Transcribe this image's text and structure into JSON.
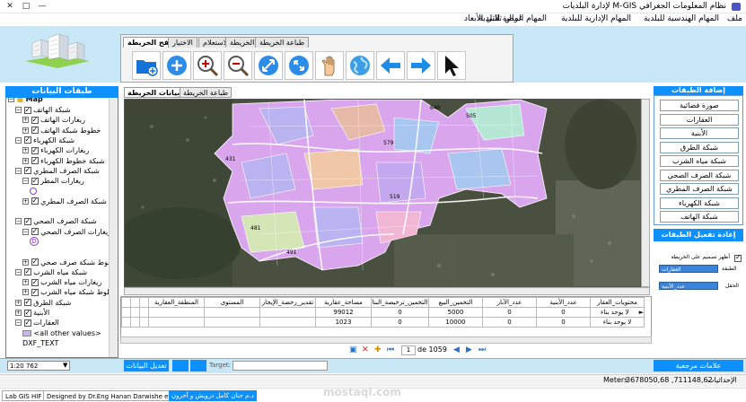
{
  "window": {
    "title": "نظام المعلومات الجغرافي M-GIS لإدارة البلديات",
    "controls": [
      "✕",
      "□",
      "—"
    ]
  },
  "menubar": {
    "items": [
      "ملف",
      "المهام الهندسية للبلدية",
      "المهام الإدارية للبلدية",
      "المهام المالية للبلدية",
      "عرض ثلاثي الأبعاد"
    ]
  },
  "ribbon": {
    "tabs": [
      "تصفح الخريطة",
      "الاختيار",
      "الاستعلام",
      "طباعة الخريطة",
      "طباعة الخريطة"
    ],
    "tools": [
      "add-layer-icon",
      "zoom-in-button-icon",
      "zoom-in-magnifier-icon",
      "zoom-out-magnifier-icon",
      "full-extent-icon",
      "fixed-zoom-icon",
      "pan-hand-icon",
      "globe-icon",
      "previous-extent-icon",
      "next-extent-icon",
      "select-arrow-icon"
    ]
  },
  "layers_panel": {
    "title": "طبقات البيانات",
    "root": "Map",
    "items": [
      {
        "indent": 1,
        "toggle": "−",
        "checked": true,
        "label": "شبكة الهاتف"
      },
      {
        "indent": 2,
        "toggle": "+",
        "checked": true,
        "label": "ريغارات الهاتف"
      },
      {
        "indent": 2,
        "toggle": "+",
        "checked": true,
        "label": "خطوط شبكة الهاتف"
      },
      {
        "indent": 1,
        "toggle": "−",
        "checked": true,
        "label": "شبكة الكهرباء"
      },
      {
        "indent": 2,
        "toggle": "+",
        "checked": true,
        "label": "ريغارات الكهرباء"
      },
      {
        "indent": 2,
        "toggle": "+",
        "checked": true,
        "label": "شبكة خطوط الكهرباء"
      },
      {
        "indent": 1,
        "toggle": "−",
        "checked": true,
        "label": "شبكة الصرف المطري"
      },
      {
        "indent": 2,
        "toggle": "−",
        "checked": true,
        "label": "ريغارات المطر"
      },
      {
        "indent": 3,
        "symbol": "circle",
        "label": ""
      },
      {
        "indent": 2,
        "toggle": "+",
        "checked": true,
        "label": "شبكة الصرف المطري"
      },
      {
        "indent": 1,
        "toggle": "",
        "checked": false,
        "label": ""
      },
      {
        "indent": 1,
        "toggle": "−",
        "checked": true,
        "label": "شبكة الصرف الصحي"
      },
      {
        "indent": 2,
        "toggle": "−",
        "checked": true,
        "label": "ريغارات الصرف الصحي"
      },
      {
        "indent": 3,
        "symbol": "D",
        "label": ""
      },
      {
        "indent": 1,
        "toggle": "",
        "checked": false,
        "label": ""
      },
      {
        "indent": 2,
        "toggle": "+",
        "checked": true,
        "label": "خطوط شبكة صرف صحي"
      },
      {
        "indent": 1,
        "toggle": "−",
        "checked": true,
        "label": "شبكة مياه الشرب"
      },
      {
        "indent": 2,
        "toggle": "+",
        "checked": true,
        "label": "ريغارات مياه الشرب"
      },
      {
        "indent": 2,
        "toggle": "+",
        "checked": true,
        "label": "خطوط شبكة مياه الشرب"
      },
      {
        "indent": 1,
        "toggle": "+",
        "checked": true,
        "label": "شبكة الطرق"
      },
      {
        "indent": 1,
        "toggle": "+",
        "checked": true,
        "label": "الأبنية"
      },
      {
        "indent": 1,
        "toggle": "−",
        "checked": true,
        "label": "العقارات"
      },
      {
        "indent": 2,
        "symbol": "swatch",
        "label": "<all other values>"
      },
      {
        "indent": 2,
        "toggle": "",
        "checked": false,
        "label": "DXF_TEXT"
      }
    ]
  },
  "map_tabs": [
    "عرض بيانات الخريطة",
    "طباعة الخريطة"
  ],
  "map": {
    "parcel_labels": [
      "640",
      "431",
      "481",
      "579",
      "505",
      "519",
      "491"
    ],
    "parcel_fill": "#d9a6ee",
    "parcel_alt": "#b9b4f1",
    "road": "#ffffff",
    "terrain": "#4a5040"
  },
  "attribute_table": {
    "columns": [
      "محتويات_العقار",
      "عدد_الأبنية",
      "عدد_الآبار",
      "التخمين_البيع",
      "التخمين_ترخيصة_البنا",
      "مساحة_عقارية",
      "تقدير_رخصة_الإيجار",
      "المستوى",
      "المنطقة_العقارية"
    ],
    "rows": [
      {
        "marker": "►",
        "cells": [
          "لا يوجد بناء",
          "0",
          "0",
          "5000",
          "0",
          "99012",
          "",
          "",
          ""
        ]
      },
      {
        "marker": "",
        "cells": [
          "لا يوجد بناء",
          "0",
          "0",
          "10000",
          "0",
          "1023",
          "",
          "",
          ""
        ]
      }
    ]
  },
  "navigator": {
    "current": "1",
    "of_label": "de 1059"
  },
  "right_panel": {
    "title": "إضافة الطبقات",
    "layer_buttons": [
      "صورة فضائية",
      "العقارات",
      "الأبنية",
      "شبكة الطرق",
      "شبكة مياه الشرب",
      "شبكة الصرف الصحي",
      "شبكة الصرف المطري",
      "شبكة الكهرباء",
      "شبكة الهاتف"
    ],
    "refresh_button": "إعادة تفعيل الطبقات",
    "overview_label": "أظهر تصميم على الخريطة",
    "layer_label": "الطبقة",
    "layer_value": "العقارات",
    "field_label": "الحقل",
    "field_value": "عدد_الأبنية"
  },
  "bottom_bar": {
    "scale": "1:20 762",
    "edit_button": "تعديل البيانات",
    "target_label": "Target:",
    "marks_button": "علامات مرجعية"
  },
  "status_bar": {
    "coords_label": "الإحداثيات",
    "coords": "3678050,68 ,711148,62",
    "units": "Meters"
  },
  "credits": {
    "lab": "Lab GIS HIF",
    "designer": "Designed by Dr.Eng Hanan Darwishe et al.",
    "arabic": "د.م حنان كامل درويش و آخرون"
  },
  "watermark": "mostaql.com",
  "colors": {
    "accent": "#0e91ff",
    "header_bg": "#c9e8f7"
  }
}
